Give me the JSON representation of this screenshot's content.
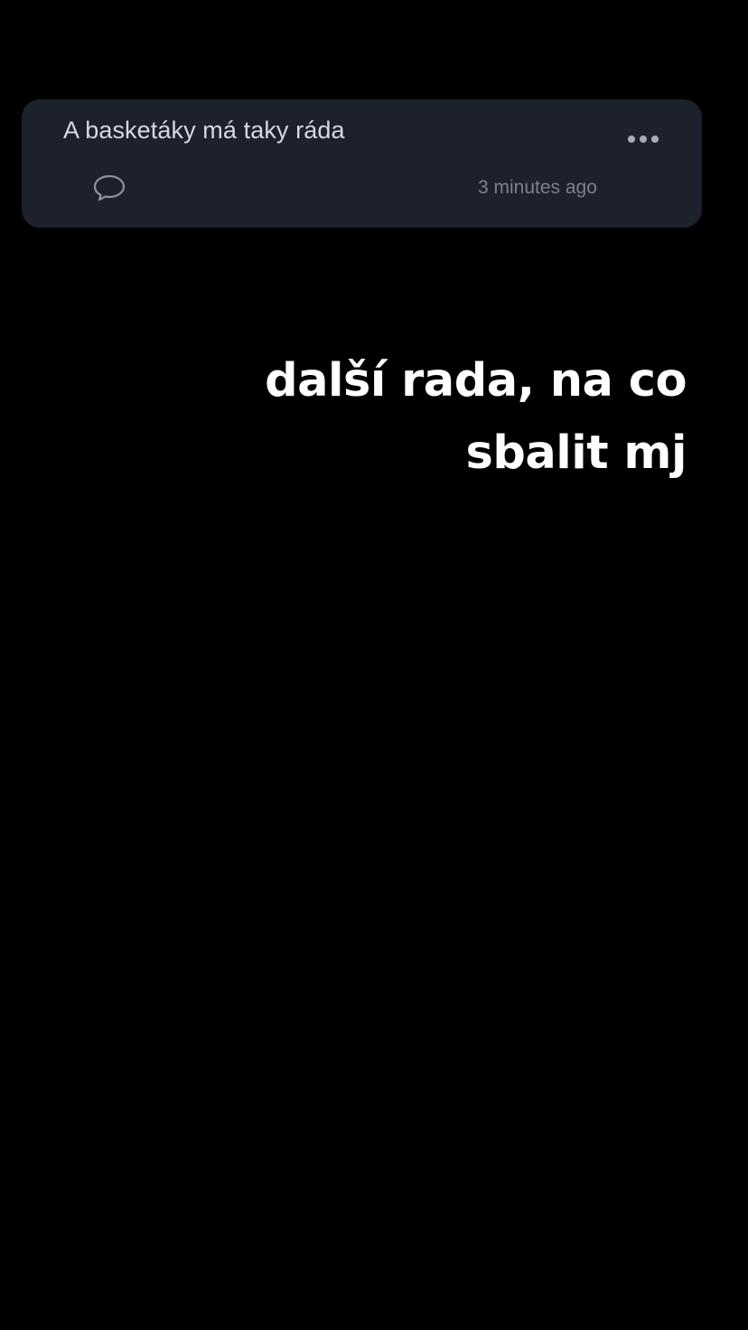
{
  "post": {
    "text": "A basketáky má taky ráda",
    "timestamp": "3 minutes ago",
    "more_icon": "ellipsis-icon",
    "comment_icon": "speech-bubble-icon"
  },
  "overlay": {
    "lines": [
      "další rada, na co",
      "sbalit mj"
    ]
  },
  "colors": {
    "background": "#000000",
    "card": "#1c212b",
    "post_text": "#d6d9de",
    "timestamp": "#7c828c",
    "caption": "#ffffff"
  }
}
